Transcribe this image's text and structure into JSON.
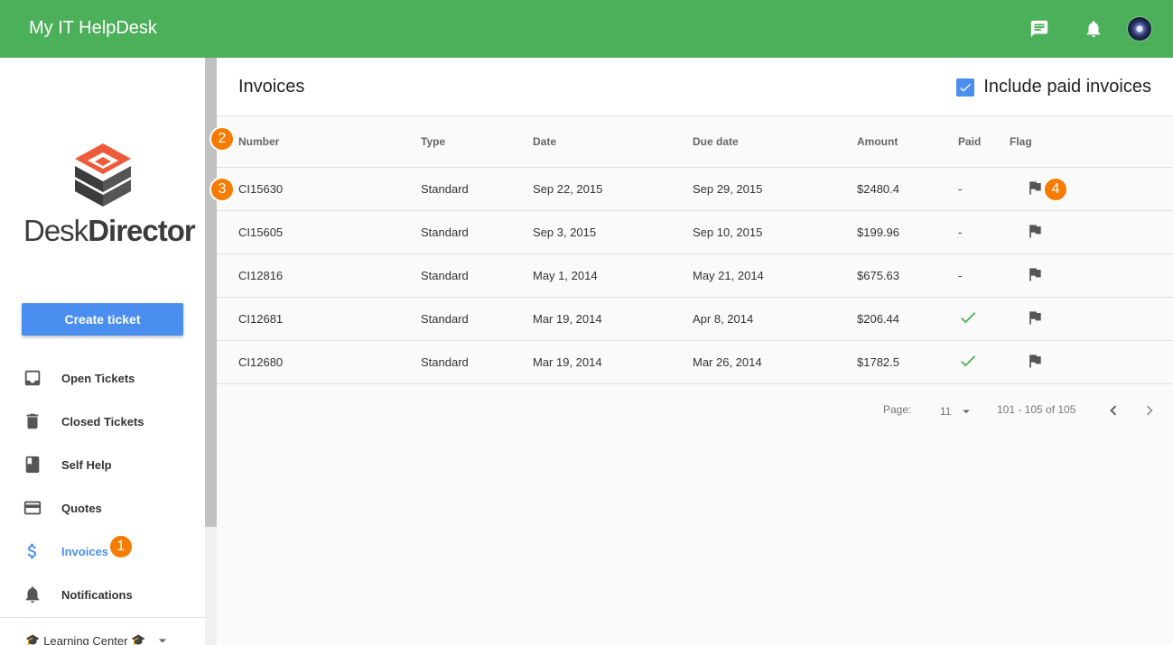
{
  "app": {
    "title": "My IT HelpDesk"
  },
  "logo": {
    "brand_light": "Desk",
    "brand_bold": "Director"
  },
  "sidebar": {
    "create_label": "Create ticket",
    "items": [
      {
        "label": "Open Tickets",
        "icon": "inbox-icon"
      },
      {
        "label": "Closed Tickets",
        "icon": "trash-icon"
      },
      {
        "label": "Self Help",
        "icon": "book-icon"
      },
      {
        "label": "Quotes",
        "icon": "credit-card-icon"
      },
      {
        "label": "Invoices",
        "icon": "dollar-icon",
        "active": true
      },
      {
        "label": "Notifications",
        "icon": "bell-icon"
      }
    ],
    "learning_label": "Learning Center"
  },
  "page": {
    "title": "Invoices",
    "include_paid_label": "Include paid invoices",
    "include_paid_checked": true
  },
  "table": {
    "headers": {
      "number": "Number",
      "type": "Type",
      "date": "Date",
      "due": "Due date",
      "amount": "Amount",
      "paid": "Paid",
      "flag": "Flag"
    },
    "rows": [
      {
        "number": "CI15630",
        "type": "Standard",
        "date": "Sep 22, 2015",
        "due": "Sep 29, 2015",
        "amount": "$2480.4",
        "paid": "-"
      },
      {
        "number": "CI15605",
        "type": "Standard",
        "date": "Sep 3, 2015",
        "due": "Sep 10, 2015",
        "amount": "$199.96",
        "paid": "-"
      },
      {
        "number": "CI12816",
        "type": "Standard",
        "date": "May 1, 2014",
        "due": "May 21, 2014",
        "amount": "$675.63",
        "paid": "-"
      },
      {
        "number": "CI12681",
        "type": "Standard",
        "date": "Mar 19, 2014",
        "due": "Apr 8, 2014",
        "amount": "$206.44",
        "paid": "check"
      },
      {
        "number": "CI12680",
        "type": "Standard",
        "date": "Mar 19, 2014",
        "due": "Mar 26, 2014",
        "amount": "$1782.5",
        "paid": "check"
      }
    ]
  },
  "pager": {
    "label": "Page:",
    "size": "11",
    "range": "101 - 105 of 105"
  },
  "badges": [
    "1",
    "2",
    "3",
    "4"
  ],
  "colors": {
    "topbar": "#4caf5a",
    "accent": "#4a8ef0",
    "badge": "#f57c00",
    "paid_check": "#4caf5a"
  }
}
